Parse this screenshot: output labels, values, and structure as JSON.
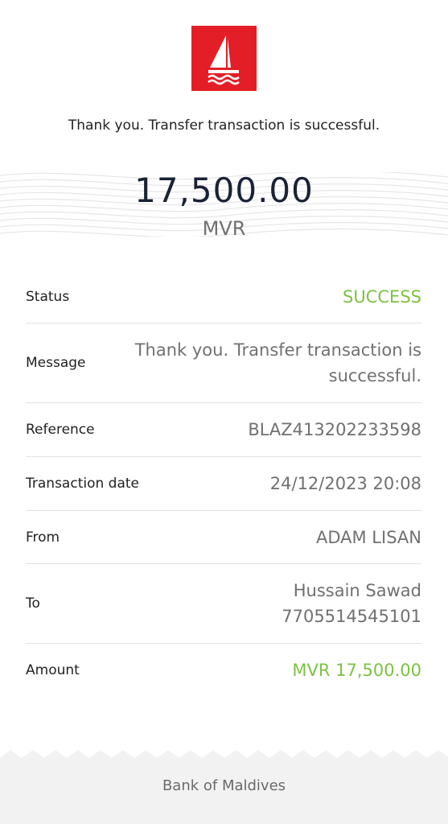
{
  "brand": {
    "logo_icon": "sailboat-logo-icon",
    "logo_color": "#e31e26"
  },
  "headline": "Thank you. Transfer transaction is successful.",
  "amount": {
    "value": "17,500.00",
    "currency": "MVR"
  },
  "details": {
    "status_label": "Status",
    "status_value": "SUCCESS",
    "message_label": "Message",
    "message_value": "Thank you. Transfer transaction is successful.",
    "reference_label": "Reference",
    "reference_value": "BLAZ413202233598",
    "date_label": "Transaction date",
    "date_value": "24/12/2023 20:08",
    "from_label": "From",
    "from_value": "ADAM LISAN",
    "to_label": "To",
    "to_name": "Hussain Sawad",
    "to_account": "7705514545101",
    "amount_label": "Amount",
    "amount_value": "MVR 17,500.00"
  },
  "colors": {
    "success_green": "#7cc242",
    "text_dark": "#1a2236",
    "text_muted": "#707070"
  },
  "footer": {
    "bank_name": "Bank of Maldives"
  }
}
